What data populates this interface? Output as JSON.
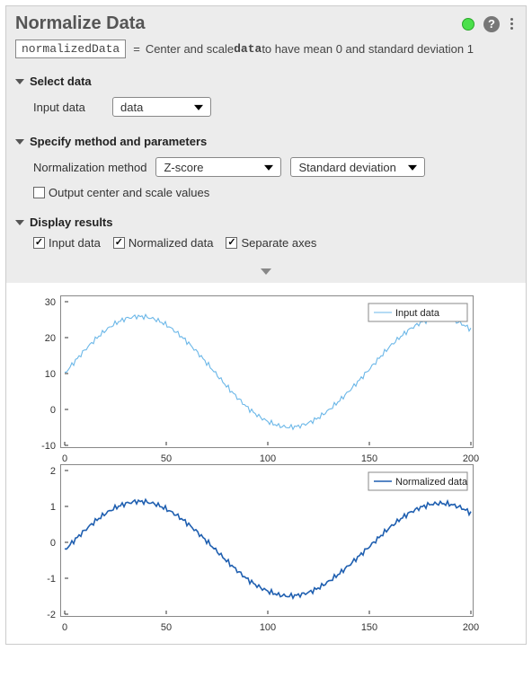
{
  "header": {
    "title": "Normalize Data"
  },
  "equation": {
    "output_var": "normalizedData",
    "eq_sign": "=",
    "desc_prefix": "Center and scale ",
    "data_var": "data",
    "desc_suffix": " to have mean 0 and standard deviation 1"
  },
  "sections": {
    "select_data": {
      "title": "Select data",
      "input_data_label": "Input data",
      "input_data_value": "data"
    },
    "method": {
      "title": "Specify method and parameters",
      "norm_method_label": "Normalization method",
      "norm_method_value": "Z-score",
      "norm_param_value": "Standard deviation",
      "output_center_label": "Output center and scale values",
      "output_center_checked": false
    },
    "display": {
      "title": "Display results",
      "input_data_label": "Input data",
      "normalized_label": "Normalized data",
      "separate_axes_label": "Separate axes"
    }
  },
  "chart_data": [
    {
      "type": "line",
      "title": "",
      "xlabel": "",
      "ylabel": "",
      "xlim": [
        0,
        200
      ],
      "ylim": [
        -10,
        30
      ],
      "xticks": [
        0,
        50,
        100,
        150,
        200
      ],
      "yticks": [
        -10,
        0,
        10,
        20,
        30
      ],
      "legend": "Input data",
      "color": "#6bb7e8",
      "x": [
        0,
        5,
        10,
        15,
        20,
        25,
        30,
        35,
        40,
        45,
        50,
        55,
        60,
        65,
        70,
        75,
        80,
        85,
        90,
        95,
        100,
        105,
        110,
        115,
        120,
        125,
        130,
        135,
        140,
        145,
        150,
        155,
        160,
        165,
        170,
        175,
        180,
        185,
        190,
        195,
        200
      ],
      "y": [
        10.0,
        13.4,
        16.6,
        19.5,
        22.0,
        24.0,
        25.3,
        25.9,
        25.8,
        25.0,
        23.6,
        21.5,
        19.0,
        16.1,
        12.9,
        9.6,
        6.3,
        3.3,
        0.5,
        -1.7,
        -3.4,
        -4.5,
        -5.0,
        -4.7,
        -3.8,
        -2.3,
        -0.2,
        2.3,
        5.1,
        8.1,
        11.2,
        14.4,
        17.5,
        20.1,
        22.4,
        24.1,
        25.1,
        25.5,
        25.1,
        24.0,
        22.3
      ]
    },
    {
      "type": "line",
      "title": "",
      "xlabel": "",
      "ylabel": "",
      "xlim": [
        0,
        200
      ],
      "ylim": [
        -2,
        2
      ],
      "xticks": [
        0,
        50,
        100,
        150,
        200
      ],
      "yticks": [
        -2,
        -1,
        0,
        1,
        2
      ],
      "legend": "Normalized data",
      "color": "#1f5fb0",
      "x": [
        0,
        5,
        10,
        15,
        20,
        25,
        30,
        35,
        40,
        45,
        50,
        55,
        60,
        65,
        70,
        75,
        80,
        85,
        90,
        95,
        100,
        105,
        110,
        115,
        120,
        125,
        130,
        135,
        140,
        145,
        150,
        155,
        160,
        165,
        170,
        175,
        180,
        185,
        190,
        195,
        200
      ],
      "y": [
        -0.22,
        0.07,
        0.34,
        0.59,
        0.8,
        0.97,
        1.08,
        1.14,
        1.13,
        1.06,
        0.93,
        0.76,
        0.55,
        0.3,
        0.03,
        -0.25,
        -0.53,
        -0.79,
        -1.03,
        -1.22,
        -1.36,
        -1.46,
        -1.5,
        -1.47,
        -1.4,
        -1.27,
        -1.09,
        -0.88,
        -0.64,
        -0.38,
        -0.12,
        0.15,
        0.41,
        0.64,
        0.83,
        0.97,
        1.06,
        1.09,
        1.06,
        0.97,
        0.82
      ]
    }
  ]
}
